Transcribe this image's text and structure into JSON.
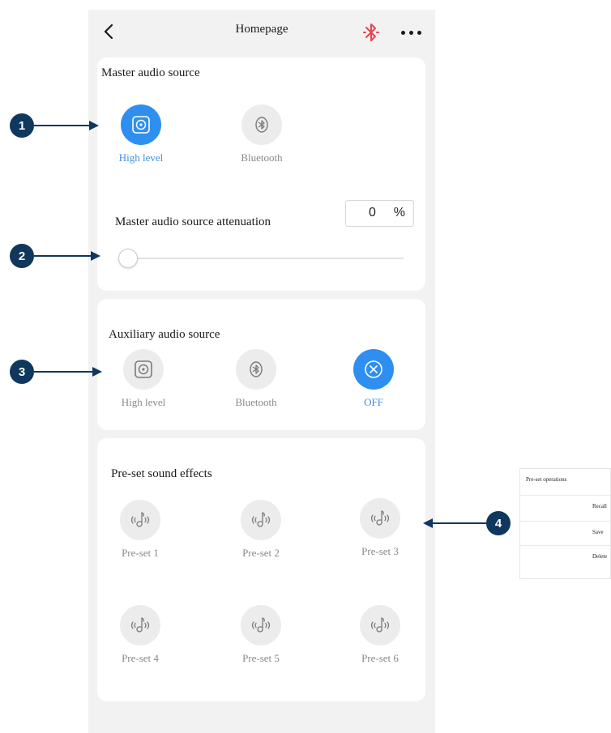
{
  "header": {
    "title": "Homepage"
  },
  "master": {
    "title": "Master audio source",
    "options": [
      {
        "label": "High level",
        "icon": "speaker-icon",
        "active": true
      },
      {
        "label": "Bluetooth",
        "icon": "bluetooth-icon",
        "active": false
      }
    ],
    "attenuation": {
      "label": "Master audio source attenuation",
      "value": "0",
      "unit": "%",
      "slider_fraction": 0
    }
  },
  "auxiliary": {
    "title": "Auxiliary audio source",
    "options": [
      {
        "label": "High level",
        "icon": "speaker-icon",
        "active": false
      },
      {
        "label": "Bluetooth",
        "icon": "bluetooth-icon",
        "active": false
      },
      {
        "label": "OFF",
        "icon": "close-icon",
        "active": true
      }
    ]
  },
  "presets": {
    "title": "Pre-set sound effects",
    "items": [
      {
        "label": "Pre-set 1"
      },
      {
        "label": "Pre-set 2"
      },
      {
        "label": "Pre-set 3"
      },
      {
        "label": "Pre-set 4"
      },
      {
        "label": "Pre-set 5"
      },
      {
        "label": "Pre-set 6"
      }
    ]
  },
  "popup": {
    "title": "Pre-set operations",
    "items": [
      "Recall",
      "Save",
      "Delete"
    ]
  },
  "callouts": [
    "1",
    "2",
    "3",
    "4"
  ],
  "colors": {
    "accent": "#2e8ff0",
    "bluetooth_status": "#e8434e",
    "callout": "#10375e",
    "card": "#ffffff",
    "background": "#f2f2f2"
  }
}
